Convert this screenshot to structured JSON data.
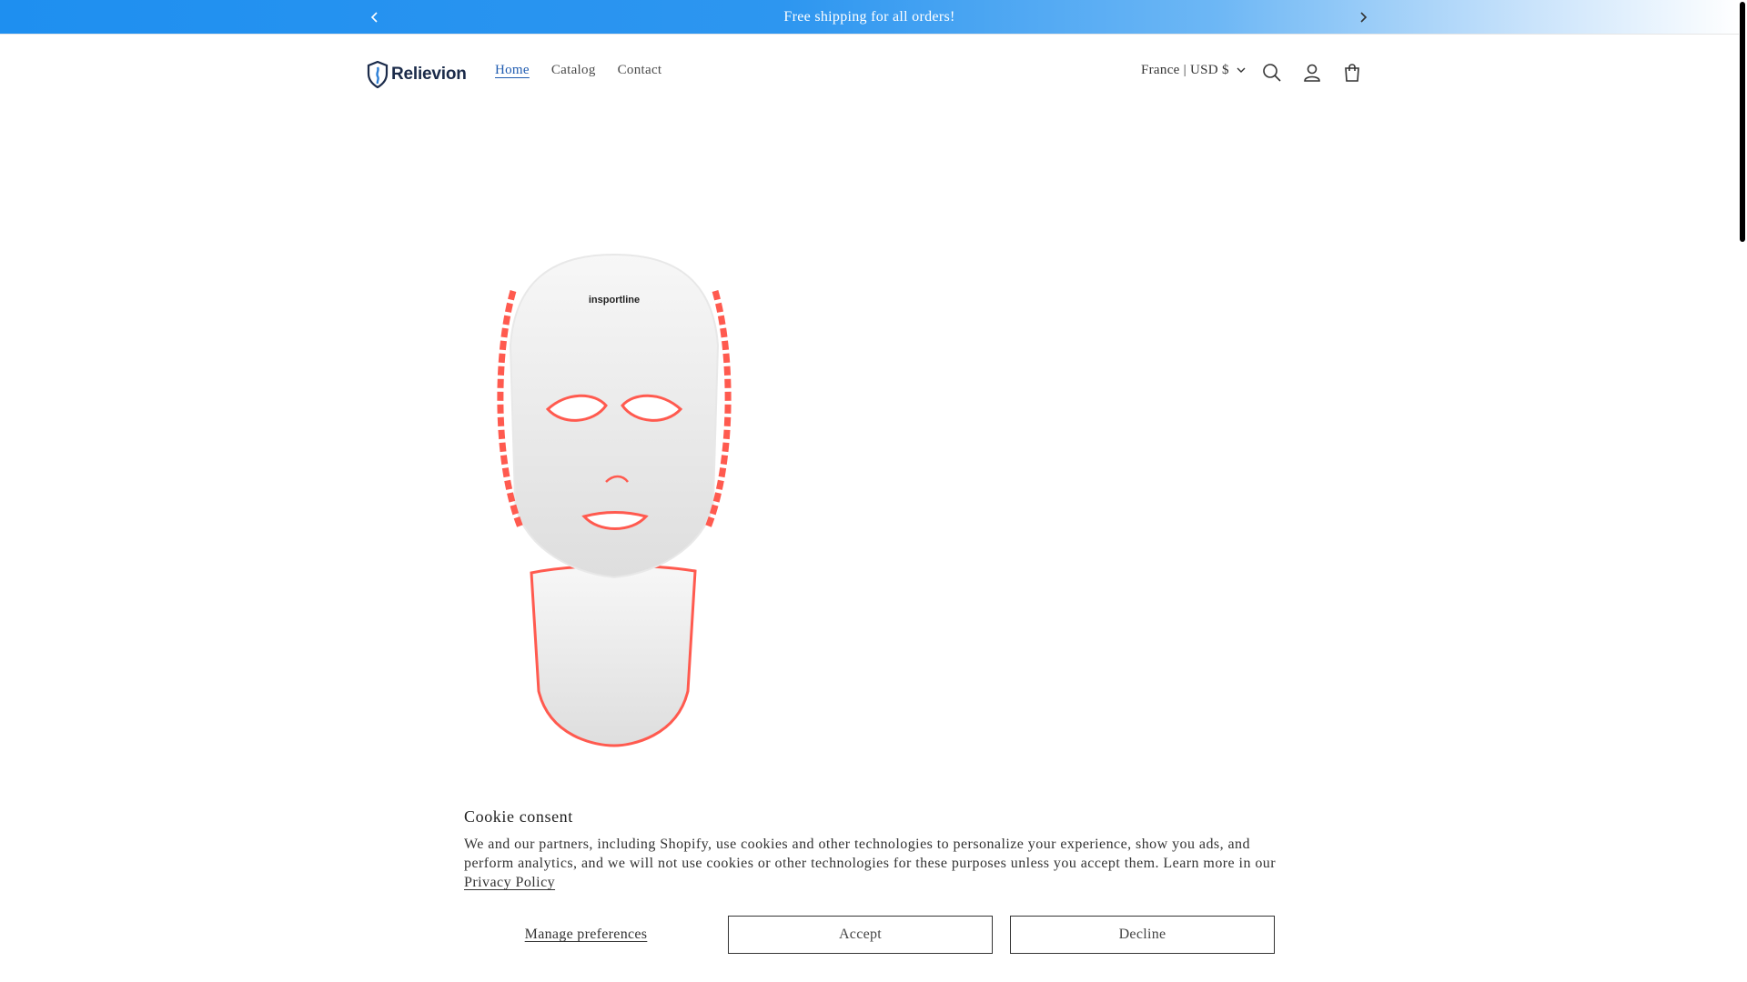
{
  "announcement": {
    "text": "Free shipping for all orders!",
    "prev_icon": "chevron-left-icon",
    "next_icon": "chevron-right-icon"
  },
  "header": {
    "logo_text": "Relievion",
    "nav": [
      {
        "label": "Home",
        "active": true
      },
      {
        "label": "Catalog",
        "active": false
      },
      {
        "label": "Contact",
        "active": false
      }
    ],
    "locale": "France | USD $",
    "icons": [
      "search-icon",
      "account-icon",
      "cart-icon"
    ]
  },
  "product": {
    "image_brand_text": "insportline",
    "image_description": "LED face and neck mask"
  },
  "cookie": {
    "title": "Cookie consent",
    "body": "We and our partners, including Shopify, use cookies and other technologies to personalize your experience, show you ads, and perform analytics, and we will not use cookies or other technologies for these purposes unless you accept them. Learn more in our",
    "link": "Privacy Policy",
    "manage_label": "Manage preferences",
    "accept_label": "Accept",
    "decline_label": "Decline"
  },
  "colors": {
    "announcement_start": "#1e8ff0",
    "nav_active": "#1f5bb0",
    "led_red": "#ff5a4f"
  }
}
